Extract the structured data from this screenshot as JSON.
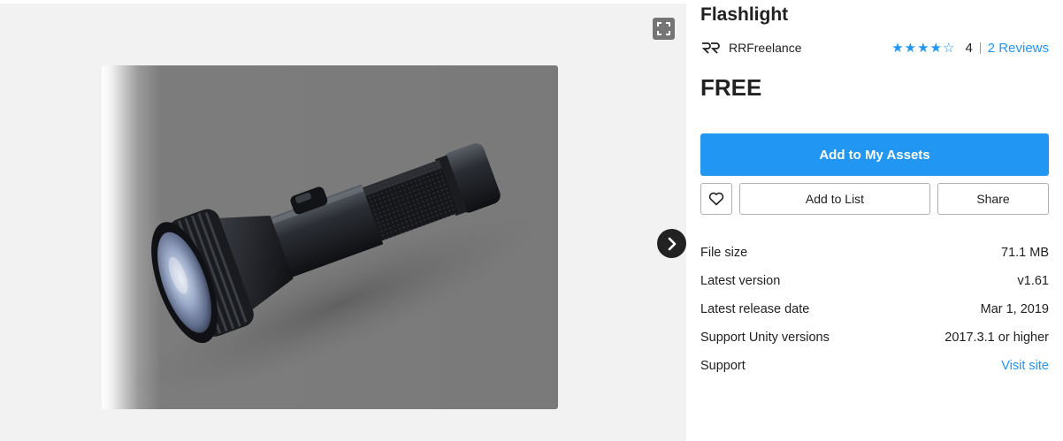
{
  "product": {
    "title": "Flashlight",
    "publisher": "RRFreelance",
    "rating": {
      "value": "4",
      "stars_filled": 4,
      "stars_total": 5,
      "reviews_link": "2 Reviews"
    },
    "price": "FREE"
  },
  "gallery": {
    "image_icon": "flashlight-product-image",
    "fullscreen_icon": "expand-icon",
    "next_icon": "chevron-right-icon"
  },
  "actions": {
    "primary": "Add to My Assets",
    "add_to_list": "Add to List",
    "share": "Share",
    "wishlist_icon": "heart-outline-icon"
  },
  "details": {
    "rows": [
      {
        "label": "File size",
        "value": "71.1 MB"
      },
      {
        "label": "Latest version",
        "value": "v1.61"
      },
      {
        "label": "Latest release date",
        "value": "Mar 1, 2019"
      },
      {
        "label": "Support Unity versions",
        "value": "2017.3.1 or higher"
      },
      {
        "label": "Support",
        "value": "Visit site"
      }
    ]
  },
  "colors": {
    "accent": "#2196f3",
    "gallery_bg": "#f2f2f2",
    "text": "#212121"
  }
}
